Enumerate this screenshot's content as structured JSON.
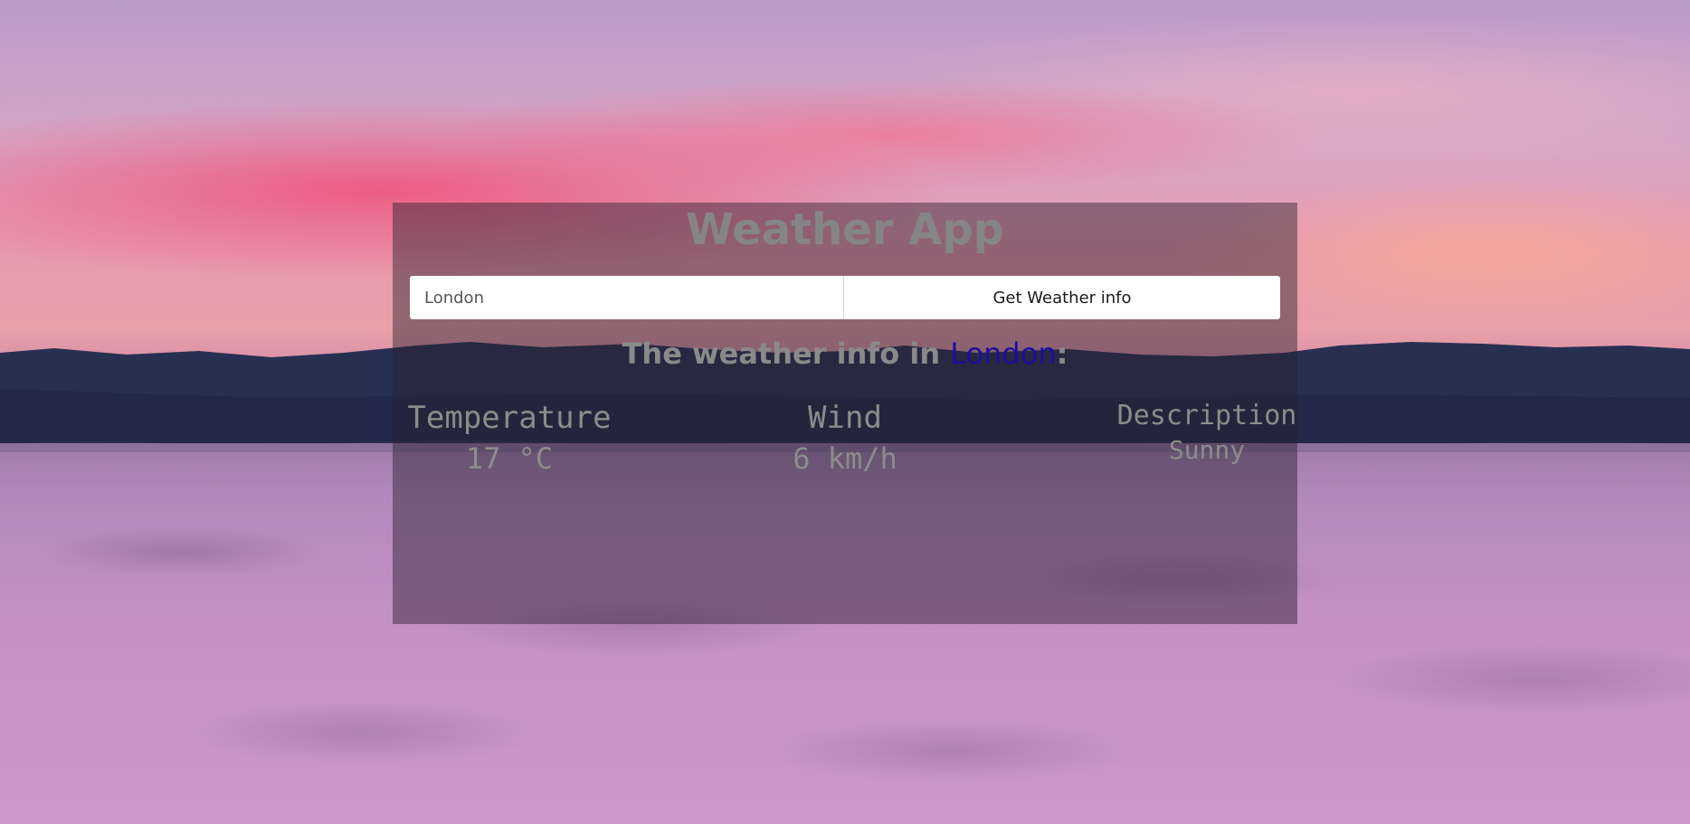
{
  "app": {
    "title": "Weather App"
  },
  "search": {
    "value": "London",
    "button_label": "Get Weather info"
  },
  "result": {
    "heading_prefix": "The weather info in ",
    "city": "London",
    "heading_suffix": ":",
    "temperature": {
      "label": "Temperature",
      "value": "17 °C"
    },
    "wind": {
      "label": "Wind",
      "value": "6 km/h"
    },
    "description": {
      "label": "Description",
      "value": "Sunny"
    }
  },
  "colors": {
    "city_link": "#1a0f9e",
    "panel_text": "#8a8a8a"
  }
}
